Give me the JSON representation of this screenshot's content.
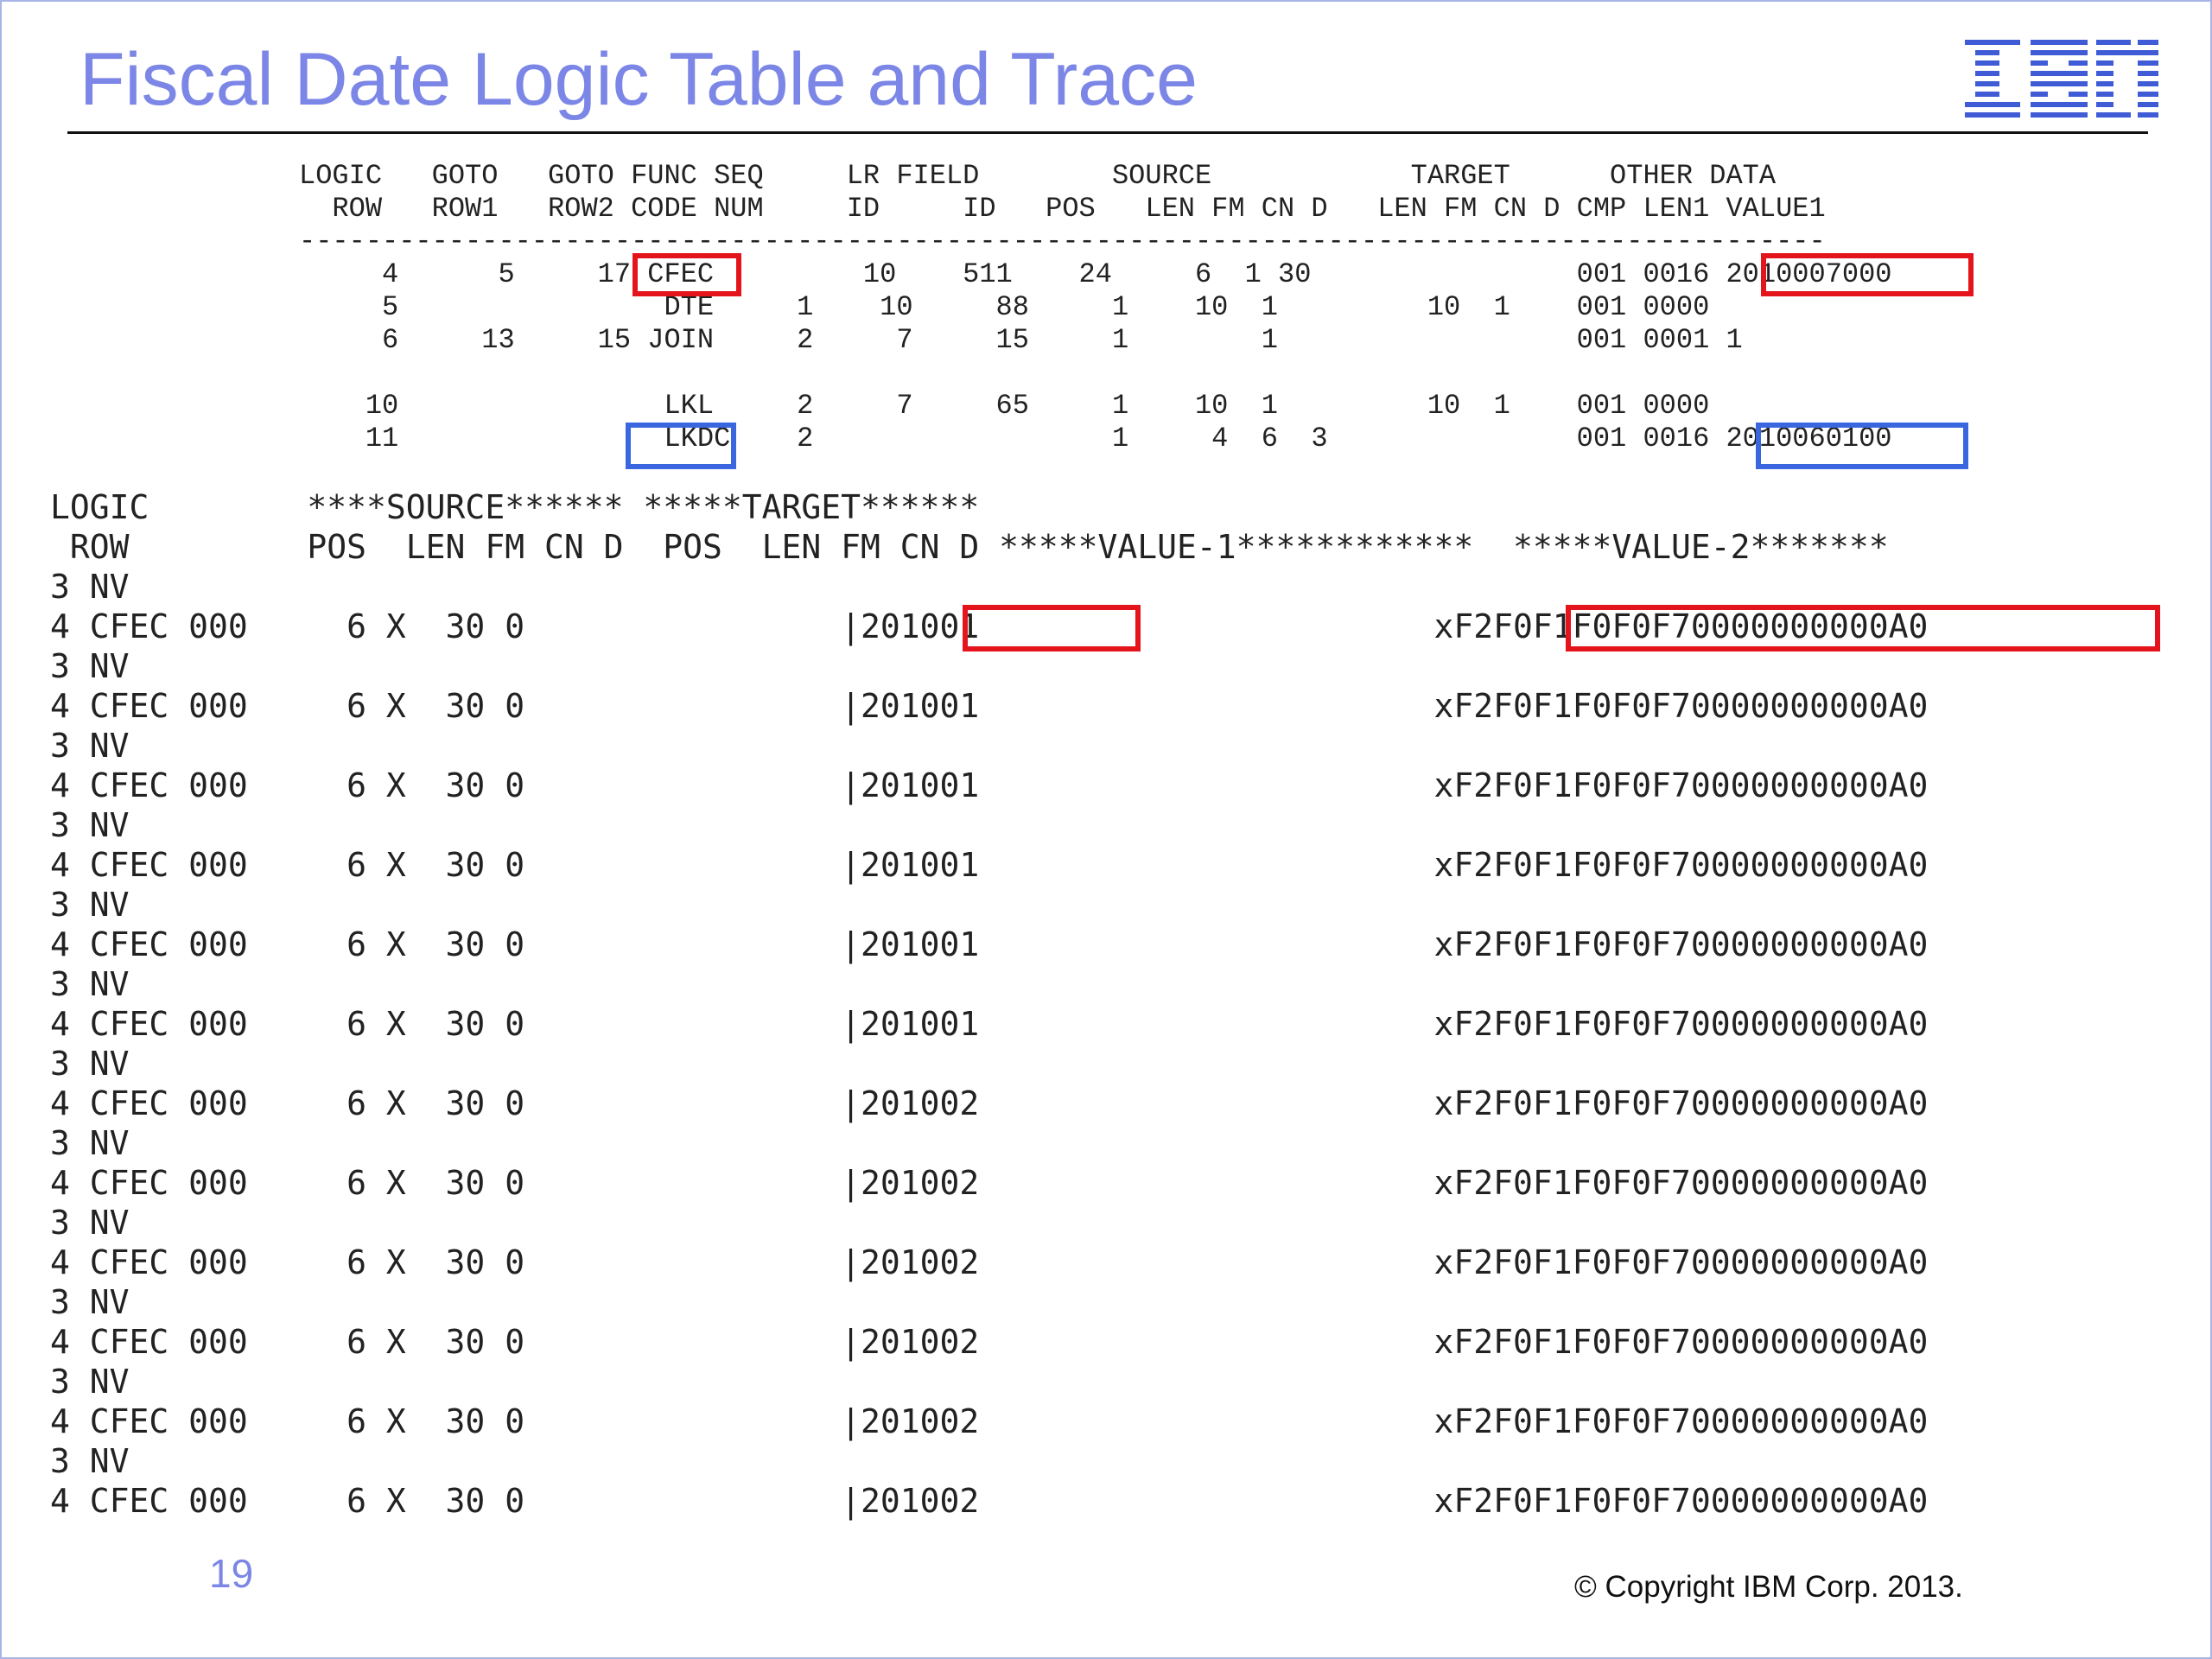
{
  "slide": {
    "title": "Fiscal Date Logic Table and Trace",
    "logo_text": "IBM",
    "page_number": "19",
    "copyright": "© Copyright IBM Corp. 2013."
  },
  "colors": {
    "title": "#7b86e6",
    "highlight_red": "#e3141b",
    "highlight_blue": "#3a66e0",
    "text": "#222222"
  },
  "logic_table": {
    "header_lines": [
      "LOGIC   GOTO   GOTO FUNC SEQ     LR FIELD        SOURCE            TARGET      OTHER DATA",
      "  ROW   ROW1   ROW2 CODE NUM     ID     ID   POS   LEN FM CN D   LEN FM CN D CMP LEN1 VALUE1",
      "--------------------------------------------------------------------------------------------"
    ],
    "rows": [
      "     4      5     17 CFEC         10    511    24     6  1 30                001 0016 2010007000",
      "     5                DTE     1    10     88     1    10  1         10  1    001 0000",
      "     6     13     15 JOIN     2     7     15     1        1                  001 0001 1",
      "",
      "    10                LKL     2     7     65     1    10  1         10  1    001 0000",
      "    11                LKDC    2                  1     4  6  3               001 0016 2010060100"
    ]
  },
  "trace": {
    "header_lines": [
      "LOGIC        ****SOURCE****** *****TARGET******",
      " ROW         POS  LEN FM CN D  POS  LEN FM CN D *****VALUE-1************  *****VALUE-2*******"
    ],
    "lines": [
      "3 NV",
      "4 CFEC 000     6 X  30 0                |201001                       xF2F0F1F0F0F70000000000A0",
      "3 NV",
      "4 CFEC 000     6 X  30 0                |201001                       xF2F0F1F0F0F70000000000A0",
      "3 NV",
      "4 CFEC 000     6 X  30 0                |201001                       xF2F0F1F0F0F70000000000A0",
      "3 NV",
      "4 CFEC 000     6 X  30 0                |201001                       xF2F0F1F0F0F70000000000A0",
      "3 NV",
      "4 CFEC 000     6 X  30 0                |201001                       xF2F0F1F0F0F70000000000A0",
      "3 NV",
      "4 CFEC 000     6 X  30 0                |201001                       xF2F0F1F0F0F70000000000A0",
      "3 NV",
      "4 CFEC 000     6 X  30 0                |201002                       xF2F0F1F0F0F70000000000A0",
      "3 NV",
      "4 CFEC 000     6 X  30 0                |201002                       xF2F0F1F0F0F70000000000A0",
      "3 NV",
      "4 CFEC 000     6 X  30 0                |201002                       xF2F0F1F0F0F70000000000A0",
      "3 NV",
      "4 CFEC 000     6 X  30 0                |201002                       xF2F0F1F0F0F70000000000A0",
      "3 NV",
      "4 CFEC 000     6 X  30 0                |201002                       xF2F0F1F0F0F70000000000A0",
      "3 NV",
      "4 CFEC 000     6 X  30 0                |201002                       xF2F0F1F0F0F70000000000A0"
    ]
  }
}
